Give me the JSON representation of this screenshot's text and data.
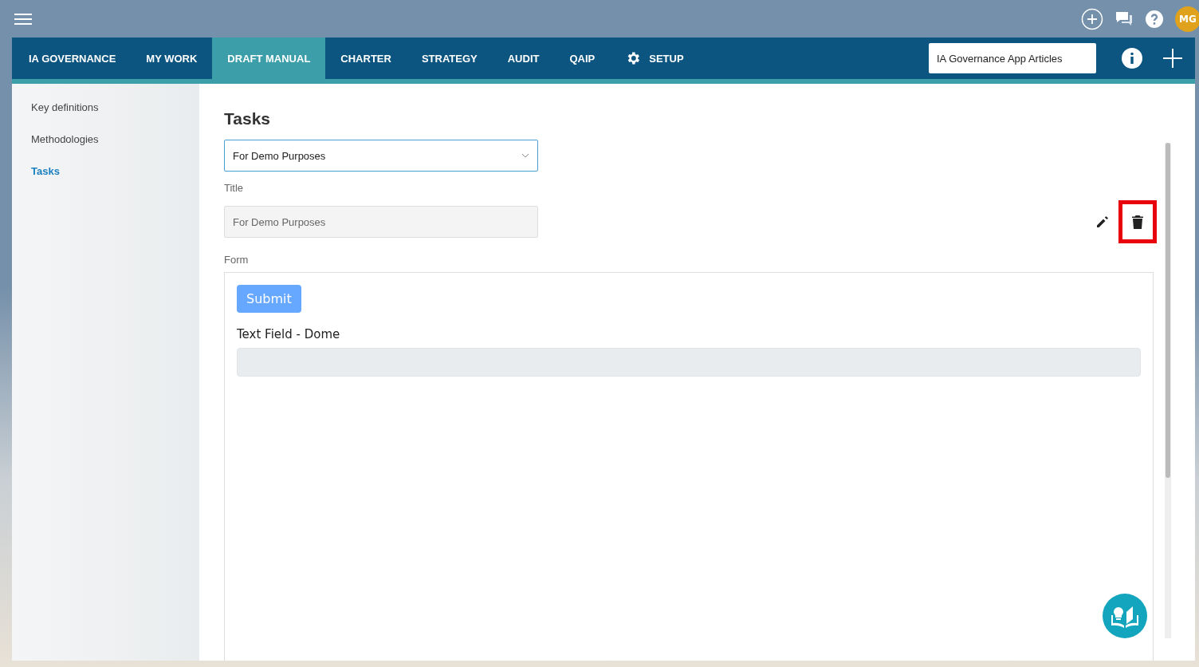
{
  "top_bar": {
    "avatar": "MG"
  },
  "nav": {
    "tabs": [
      {
        "label": "IA GOVERNANCE",
        "selected": false,
        "kind": "plain"
      },
      {
        "label": "MY WORK",
        "selected": false,
        "kind": "plain"
      },
      {
        "label": "DRAFT MANUAL",
        "selected": true,
        "kind": "plain"
      },
      {
        "label": "CHARTER",
        "selected": false,
        "kind": "plain"
      },
      {
        "label": "STRATEGY",
        "selected": false,
        "kind": "plain"
      },
      {
        "label": "AUDIT",
        "selected": false,
        "kind": "plain"
      },
      {
        "label": "QAIP",
        "selected": false,
        "kind": "plain"
      },
      {
        "label": "SETUP",
        "selected": false,
        "kind": "settings"
      }
    ],
    "search": {
      "value": "IA Governance App Articles"
    }
  },
  "sidebar": {
    "items": [
      {
        "label": "Key definitions",
        "selected": false
      },
      {
        "label": "Methodologies",
        "selected": false
      },
      {
        "label": "Tasks",
        "selected": true
      }
    ]
  },
  "content": {
    "heading": "Tasks",
    "select": {
      "value": "For Demo Purposes"
    },
    "title_label": "Title",
    "title_field": {
      "value": "For Demo Purposes"
    },
    "delete_highlighted": true,
    "form_label": "Form",
    "form": {
      "submit": "Submit",
      "field_label": "Text Field - Dome"
    }
  }
}
